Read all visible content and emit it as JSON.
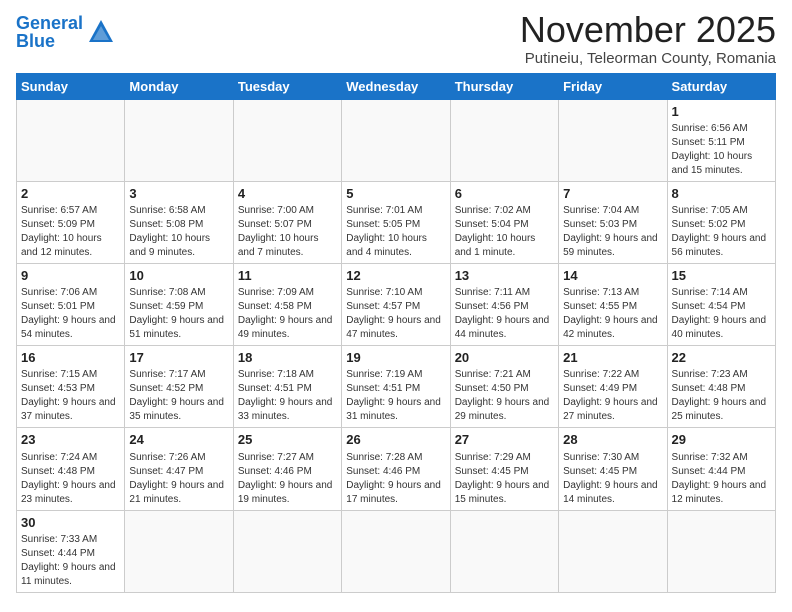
{
  "header": {
    "logo_general": "General",
    "logo_blue": "Blue",
    "month_title": "November 2025",
    "subtitle": "Putineiu, Teleorman County, Romania"
  },
  "weekdays": [
    "Sunday",
    "Monday",
    "Tuesday",
    "Wednesday",
    "Thursday",
    "Friday",
    "Saturday"
  ],
  "weeks": [
    [
      {
        "day": "",
        "info": ""
      },
      {
        "day": "",
        "info": ""
      },
      {
        "day": "",
        "info": ""
      },
      {
        "day": "",
        "info": ""
      },
      {
        "day": "",
        "info": ""
      },
      {
        "day": "",
        "info": ""
      },
      {
        "day": "1",
        "info": "Sunrise: 6:56 AM\nSunset: 5:11 PM\nDaylight: 10 hours and 15 minutes."
      }
    ],
    [
      {
        "day": "2",
        "info": "Sunrise: 6:57 AM\nSunset: 5:09 PM\nDaylight: 10 hours and 12 minutes."
      },
      {
        "day": "3",
        "info": "Sunrise: 6:58 AM\nSunset: 5:08 PM\nDaylight: 10 hours and 9 minutes."
      },
      {
        "day": "4",
        "info": "Sunrise: 7:00 AM\nSunset: 5:07 PM\nDaylight: 10 hours and 7 minutes."
      },
      {
        "day": "5",
        "info": "Sunrise: 7:01 AM\nSunset: 5:05 PM\nDaylight: 10 hours and 4 minutes."
      },
      {
        "day": "6",
        "info": "Sunrise: 7:02 AM\nSunset: 5:04 PM\nDaylight: 10 hours and 1 minute."
      },
      {
        "day": "7",
        "info": "Sunrise: 7:04 AM\nSunset: 5:03 PM\nDaylight: 9 hours and 59 minutes."
      },
      {
        "day": "8",
        "info": "Sunrise: 7:05 AM\nSunset: 5:02 PM\nDaylight: 9 hours and 56 minutes."
      }
    ],
    [
      {
        "day": "9",
        "info": "Sunrise: 7:06 AM\nSunset: 5:01 PM\nDaylight: 9 hours and 54 minutes."
      },
      {
        "day": "10",
        "info": "Sunrise: 7:08 AM\nSunset: 4:59 PM\nDaylight: 9 hours and 51 minutes."
      },
      {
        "day": "11",
        "info": "Sunrise: 7:09 AM\nSunset: 4:58 PM\nDaylight: 9 hours and 49 minutes."
      },
      {
        "day": "12",
        "info": "Sunrise: 7:10 AM\nSunset: 4:57 PM\nDaylight: 9 hours and 47 minutes."
      },
      {
        "day": "13",
        "info": "Sunrise: 7:11 AM\nSunset: 4:56 PM\nDaylight: 9 hours and 44 minutes."
      },
      {
        "day": "14",
        "info": "Sunrise: 7:13 AM\nSunset: 4:55 PM\nDaylight: 9 hours and 42 minutes."
      },
      {
        "day": "15",
        "info": "Sunrise: 7:14 AM\nSunset: 4:54 PM\nDaylight: 9 hours and 40 minutes."
      }
    ],
    [
      {
        "day": "16",
        "info": "Sunrise: 7:15 AM\nSunset: 4:53 PM\nDaylight: 9 hours and 37 minutes."
      },
      {
        "day": "17",
        "info": "Sunrise: 7:17 AM\nSunset: 4:52 PM\nDaylight: 9 hours and 35 minutes."
      },
      {
        "day": "18",
        "info": "Sunrise: 7:18 AM\nSunset: 4:51 PM\nDaylight: 9 hours and 33 minutes."
      },
      {
        "day": "19",
        "info": "Sunrise: 7:19 AM\nSunset: 4:51 PM\nDaylight: 9 hours and 31 minutes."
      },
      {
        "day": "20",
        "info": "Sunrise: 7:21 AM\nSunset: 4:50 PM\nDaylight: 9 hours and 29 minutes."
      },
      {
        "day": "21",
        "info": "Sunrise: 7:22 AM\nSunset: 4:49 PM\nDaylight: 9 hours and 27 minutes."
      },
      {
        "day": "22",
        "info": "Sunrise: 7:23 AM\nSunset: 4:48 PM\nDaylight: 9 hours and 25 minutes."
      }
    ],
    [
      {
        "day": "23",
        "info": "Sunrise: 7:24 AM\nSunset: 4:48 PM\nDaylight: 9 hours and 23 minutes."
      },
      {
        "day": "24",
        "info": "Sunrise: 7:26 AM\nSunset: 4:47 PM\nDaylight: 9 hours and 21 minutes."
      },
      {
        "day": "25",
        "info": "Sunrise: 7:27 AM\nSunset: 4:46 PM\nDaylight: 9 hours and 19 minutes."
      },
      {
        "day": "26",
        "info": "Sunrise: 7:28 AM\nSunset: 4:46 PM\nDaylight: 9 hours and 17 minutes."
      },
      {
        "day": "27",
        "info": "Sunrise: 7:29 AM\nSunset: 4:45 PM\nDaylight: 9 hours and 15 minutes."
      },
      {
        "day": "28",
        "info": "Sunrise: 7:30 AM\nSunset: 4:45 PM\nDaylight: 9 hours and 14 minutes."
      },
      {
        "day": "29",
        "info": "Sunrise: 7:32 AM\nSunset: 4:44 PM\nDaylight: 9 hours and 12 minutes."
      }
    ],
    [
      {
        "day": "30",
        "info": "Sunrise: 7:33 AM\nSunset: 4:44 PM\nDaylight: 9 hours and 11 minutes."
      },
      {
        "day": "",
        "info": ""
      },
      {
        "day": "",
        "info": ""
      },
      {
        "day": "",
        "info": ""
      },
      {
        "day": "",
        "info": ""
      },
      {
        "day": "",
        "info": ""
      },
      {
        "day": "",
        "info": ""
      }
    ]
  ]
}
